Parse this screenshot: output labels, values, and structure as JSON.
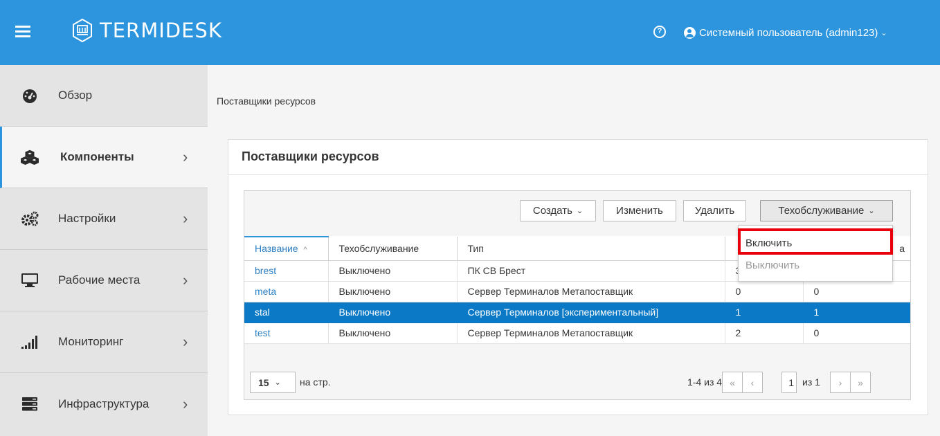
{
  "app": {
    "title": "TERMIDESK",
    "help_glyph": "?",
    "user_label": "Системный пользователь (admin123)",
    "user_caret": "⌄",
    "colors": {
      "header": "#2c95dd",
      "accent": "#2c95dd",
      "selected_row": "#0b79c5",
      "highlight_box": "#e8000b",
      "link": "#2c7fc3"
    }
  },
  "sidebar": {
    "items": [
      {
        "label": "Обзор",
        "icon": "dashboard-icon",
        "chevron": ""
      },
      {
        "label": "Компоненты",
        "icon": "cubes-icon",
        "chevron": "›",
        "active": true
      },
      {
        "label": "Настройки",
        "icon": "gears-icon",
        "chevron": "›"
      },
      {
        "label": "Рабочие места",
        "icon": "monitor-icon",
        "chevron": "›"
      },
      {
        "label": "Мониторинг",
        "icon": "bar-chart-icon",
        "chevron": "›"
      },
      {
        "label": "Инфраструктура",
        "icon": "server-icon",
        "chevron": "›"
      }
    ]
  },
  "breadcrumb": "Поставщики ресурсов",
  "panel": {
    "title": "Поставщики ресурсов",
    "toolbar": {
      "create": "Создать",
      "edit": "Изменить",
      "delete": "Удалить",
      "maintenance": "Техобслуживание",
      "caret": "⌄"
    },
    "columns": [
      "Название",
      "Техобслуживание",
      "Тип",
      "",
      "a"
    ],
    "sort_indicator": "^",
    "rows": [
      {
        "name": "brest",
        "maintenance": "Выключено",
        "type": "ПК СВ Брест",
        "c4": "3",
        "c5": "",
        "selected": false
      },
      {
        "name": "meta",
        "maintenance": "Выключено",
        "type": "Сервер Терминалов Метапоставщик",
        "c4": "0",
        "c5": "0",
        "selected": false
      },
      {
        "name": "stal",
        "maintenance": "Выключено",
        "type": "Сервер Терминалов [экспериментальный]",
        "c4": "1",
        "c5": "1",
        "selected": true
      },
      {
        "name": "test",
        "maintenance": "Выключено",
        "type": "Сервер Терминалов Метапоставщик",
        "c4": "2",
        "c5": "0",
        "selected": false
      }
    ],
    "pager": {
      "per_page": "15",
      "per_page_caret": "⌄",
      "per_page_label": "на стр.",
      "range": "1-4 из 4",
      "first": "«",
      "prev": "‹",
      "page": "1",
      "of": "из 1",
      "next": "›",
      "last": "»"
    }
  },
  "dropdown": {
    "items": [
      {
        "label": "Включить",
        "enabled": true
      },
      {
        "label": "Выключить",
        "enabled": false
      }
    ]
  }
}
